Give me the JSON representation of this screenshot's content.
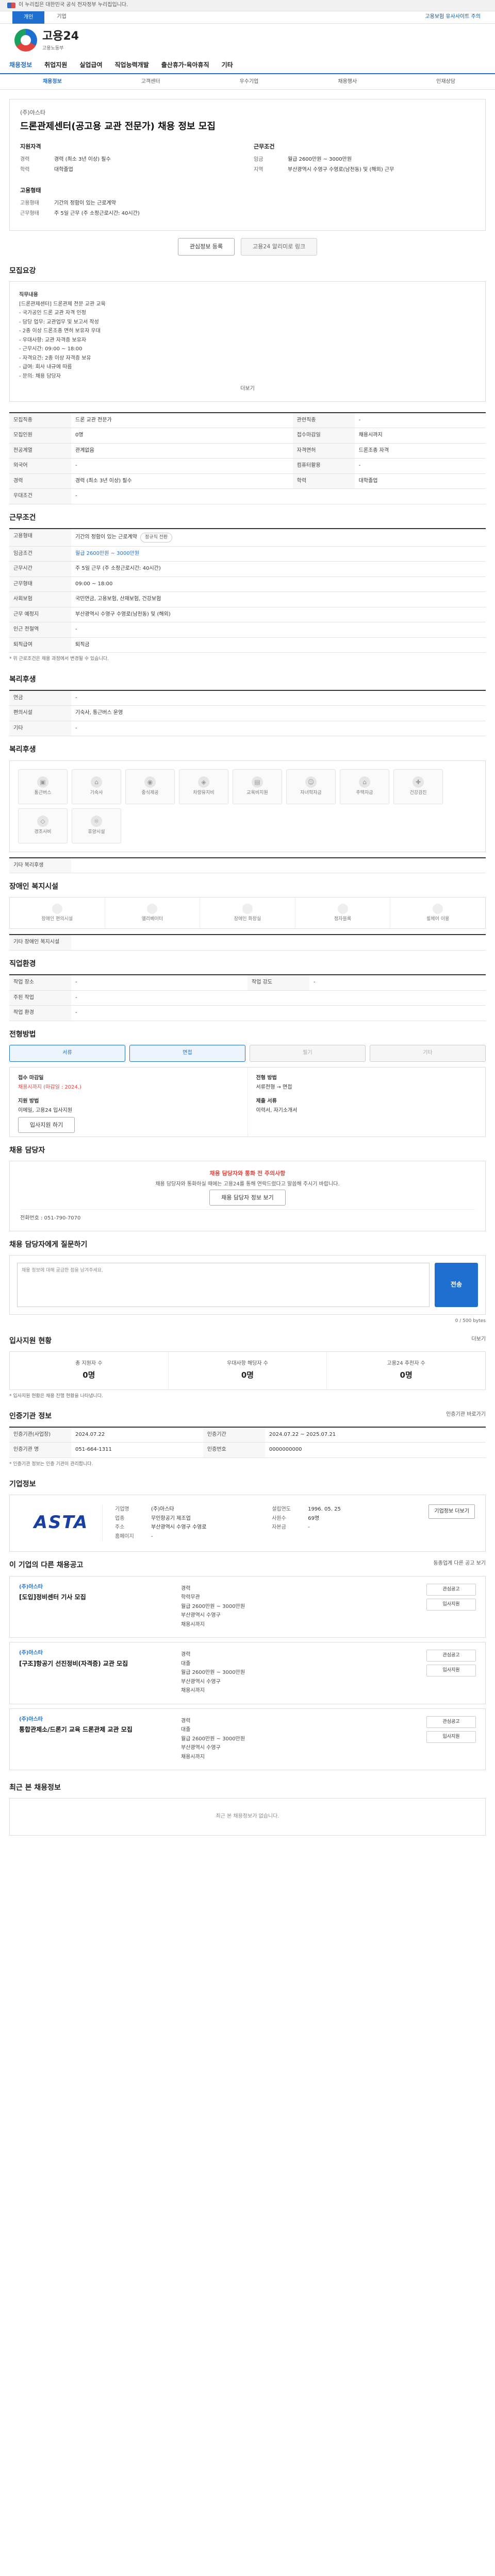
{
  "gov_banner": {
    "text": "이 누리집은 대한민국 공식 전자정부 누리집입니다."
  },
  "util": {
    "tab_personal": "개인",
    "tab_company": "기업",
    "notice": "고용보험 유사사이트 주의"
  },
  "logo": {
    "name": "고용24",
    "sub": "고용노동부"
  },
  "nav": {
    "items": [
      "채용정보",
      "취업지원",
      "실업급여",
      "직업능력개발",
      "출산휴가·육아휴직",
      "기타"
    ]
  },
  "subnav": {
    "items": [
      "채용정보",
      "고객센터",
      "우수기업",
      "채용행사",
      "인재상담"
    ]
  },
  "posting": {
    "company": "(주)아스타",
    "title": "드론관제센터(공고용 교관 전문가) 채용 정보 모집",
    "left_title": "지원자격",
    "right_title": "근무조건",
    "left": [
      {
        "k": "경력",
        "v": "경력 (최소 3년 이상) 필수"
      },
      {
        "k": "학력",
        "v": "대학졸업"
      }
    ],
    "right": [
      {
        "k": "임금",
        "v": "월급 2600만원 ~ 3000만원"
      },
      {
        "k": "지역",
        "v": "부산광역시 수영구 수영로(남천동) 및 (해외) 근무"
      }
    ],
    "left2_title": "고용형태",
    "left2": [
      {
        "k": "고용형태",
        "v": "기간의 정함이 있는 근로계약"
      },
      {
        "k": "근무형태",
        "v": "주 5일 근무 (주 소정근로시간: 40시간)"
      }
    ],
    "btn_scrap": "관심정보 등록",
    "btn_share": "고용24 알리미로 링크"
  },
  "jd": {
    "title": "모집요강",
    "lines": [
      "직무내용",
      "[드론관제센터] 드론관제 전문 교관 교육",
      "- 국가공인 드론 교관 자격 인정",
      "- 담당 업무: 교관업무 및 보고서 작성",
      "- 2종 이상 드론조종 면허 보유자 우대",
      "- 우대사항: 교관 자격증 보유자",
      "- 근무시간: 09:00 ~ 18:00",
      "- 자격요건: 2종 이상 자격증 보유",
      "- 급여: 회사 내규에 따름",
      "- 문의: 채용 담당자"
    ],
    "more": "더보기"
  },
  "summary": {
    "title": "모집요강",
    "rows": [
      {
        "k": "모집직종",
        "v": "드론 교관 전문가",
        "k2": "관련직종",
        "v2": "-"
      },
      {
        "k": "모집인원",
        "v": "0명",
        "k2": "접수마감일",
        "v2": "채용시까지"
      },
      {
        "k": "전공계열",
        "v": "관계없음",
        "k2": "자격면허",
        "v2": "드론조종 자격"
      },
      {
        "k": "외국어",
        "v": "-",
        "k2": "컴퓨터활용",
        "v2": "-"
      },
      {
        "k": "경력",
        "v": "경력 (최소 3년 이상) 필수",
        "k2": "학력",
        "v2": "대학졸업"
      },
      {
        "k": "우대조건",
        "v": "-",
        "k2": "",
        "v2": ""
      }
    ]
  },
  "conditions": {
    "title": "근무조건",
    "wage_k": "고용형태",
    "wage_v": "기간의 정함이 있는 근로계약",
    "tag": "정규직 전환",
    "pay_k": "임금조건",
    "pay_v": "월급 2600만원 ~ 3000만원",
    "rows": [
      {
        "k": "근무시간",
        "v": "주 5일 근무 (주 소정근로시간: 40시간)"
      },
      {
        "k": "근무형태",
        "v": "09:00 ~ 18:00"
      },
      {
        "k": "사회보험",
        "v": "국민연금, 고용보험, 산재보험, 건강보험"
      },
      {
        "k": "근무 예정지",
        "v": "부산광역시 수영구 수영로(남천동) 및 (해외)"
      },
      {
        "k": "인근 전철역",
        "v": "-"
      },
      {
        "k": "퇴직급여",
        "v": "퇴직금"
      }
    ],
    "note": "* 위 근로조건은 채용 과정에서 변경될 수 있습니다."
  },
  "bokri": {
    "title": "복리후생",
    "rows": [
      {
        "k": "연금",
        "v": "-"
      },
      {
        "k": "편의시설",
        "v": "기숙사, 통근버스 운영"
      },
      {
        "k": "기타",
        "v": "-"
      }
    ]
  },
  "welfare": {
    "title": "복리후생",
    "items": [
      "통근버스",
      "기숙사",
      "중식제공",
      "차량유지비",
      "교육비지원",
      "자녀학자금",
      "주택자금",
      "건강검진",
      "경조사비",
      "휴양시설"
    ],
    "etc": "기타 복리후생"
  },
  "care": {
    "title": "장애인 복지시설",
    "items": [
      "장애인 편의시설",
      "엘리베이터",
      "장애인 화장실",
      "점자블록",
      "휠체어 이용"
    ],
    "etc": "기타 장애인 복지시설"
  },
  "jobinfo": {
    "title": "직업환경",
    "rows": [
      {
        "k": "작업 장소",
        "v": "-",
        "k2": "작업 강도",
        "v2": "-"
      },
      {
        "k": "주된 작업",
        "v": "-",
        "k2": "",
        "v2": ""
      },
      {
        "k": "작업 환경",
        "v": "-",
        "k2": "",
        "v2": ""
      }
    ]
  },
  "method": {
    "title": "전형방법",
    "tabs": [
      "서류",
      "면접",
      "필기",
      "기타"
    ],
    "receipt_k": "접수 마감일",
    "receipt_v": "채용시까지 (마감일 : 2024.)",
    "method_k": "전형 방법",
    "method_v": "서류전형 → 면접",
    "docs_k": "제출 서류",
    "docs_v": "이력서, 자기소개서",
    "apply_k": "지원 방법",
    "apply_v": "이메일, 고용24 입사지원",
    "btn": "입사지원 하기"
  },
  "manager": {
    "title": "채용 담당자",
    "warn": "채용 담당자와 통화 전 주의사항",
    "desc": "채용 담당자와 통화하실 때에는 고용24를 통해 연락드렸다고 말씀해 주시기 바랍니다.",
    "btn": "채용 담당자 정보 보기",
    "phone_k": "전화번호",
    "phone_v": "051-790-7070"
  },
  "question": {
    "title": "채용 담당자에게 질문하기",
    "placeholder": "채용 정보에 대해 궁금한 점을 남겨주세요.",
    "send": "전송",
    "hint": "0 / 500 bytes"
  },
  "stats": {
    "title": "입사지원 현황",
    "link": "더보기",
    "items": [
      {
        "k": "총 지원자 수",
        "v": "0명"
      },
      {
        "k": "우대사항 해당자 수",
        "v": "0명"
      },
      {
        "k": "고용24 추천자 수",
        "v": "0명"
      }
    ],
    "note": "* 입사지원 현황은 채용 진행 현황을 나타냅니다."
  },
  "register": {
    "title": "인증기관 정보",
    "link": "인증기관 바로가기",
    "rows": [
      {
        "k": "인증기관(사업장)",
        "v": "2024.07.22",
        "k2": "인증기간",
        "v2": "2024.07.22 ~ 2025.07.21"
      },
      {
        "k": "인증기관 명",
        "v": "051-664-1311",
        "k2": "인증번호",
        "v2": "0000000000"
      }
    ],
    "note": "* 인증기관 정보는 인증 기관이 관리합니다."
  },
  "company": {
    "title": "기업정보",
    "logo": "ASTA",
    "rows": [
      {
        "k": "기업명",
        "v": "(주)아스타"
      },
      {
        "k": "업종",
        "v": "무인항공기 제조업"
      },
      {
        "k": "주소",
        "v": "부산광역시 수영구 수영로"
      },
      {
        "k": "홈페이지",
        "v": "-"
      }
    ],
    "rows2": [
      {
        "k": "설립연도",
        "v": "1996. 05. 25"
      },
      {
        "k": "사원수",
        "v": "69명"
      },
      {
        "k": "자본금",
        "v": "-"
      }
    ],
    "btn": "기업정보 더보기"
  },
  "others": {
    "title": "이 기업의 다른 채용공고",
    "link": "동종업계 다른 공고 보기",
    "items": [
      {
        "co": "(주)아스타",
        "title": "[도입]정비센터 기사 모집",
        "a": "경력",
        "b": "학력무관",
        "c": "월급 2600만원 ~ 3000만원",
        "d": "부산광역시 수영구",
        "e": "채용시까지",
        "btn1": "관심공고",
        "btn2": "입사지원"
      },
      {
        "co": "(주)아스타",
        "title": "[구조]항공기 선진정비(자격증) 교관 모집",
        "a": "경력",
        "b": "대졸",
        "c": "월급 2600만원 ~ 3000만원",
        "d": "부산광역시 수영구",
        "e": "채용시까지",
        "btn1": "관심공고",
        "btn2": "입사지원"
      },
      {
        "co": "(주)아스타",
        "title": "통합관제소/드론기 교육 드론관제 교관 모집",
        "a": "경력",
        "b": "대졸",
        "c": "월급 2600만원 ~ 3000만원",
        "d": "부산광역시 수영구",
        "e": "채용시까지",
        "btn1": "관심공고",
        "btn2": "입사지원"
      }
    ]
  },
  "recent": {
    "title": "최근 본 채용정보",
    "empty": "최근 본 채용정보가 없습니다."
  }
}
